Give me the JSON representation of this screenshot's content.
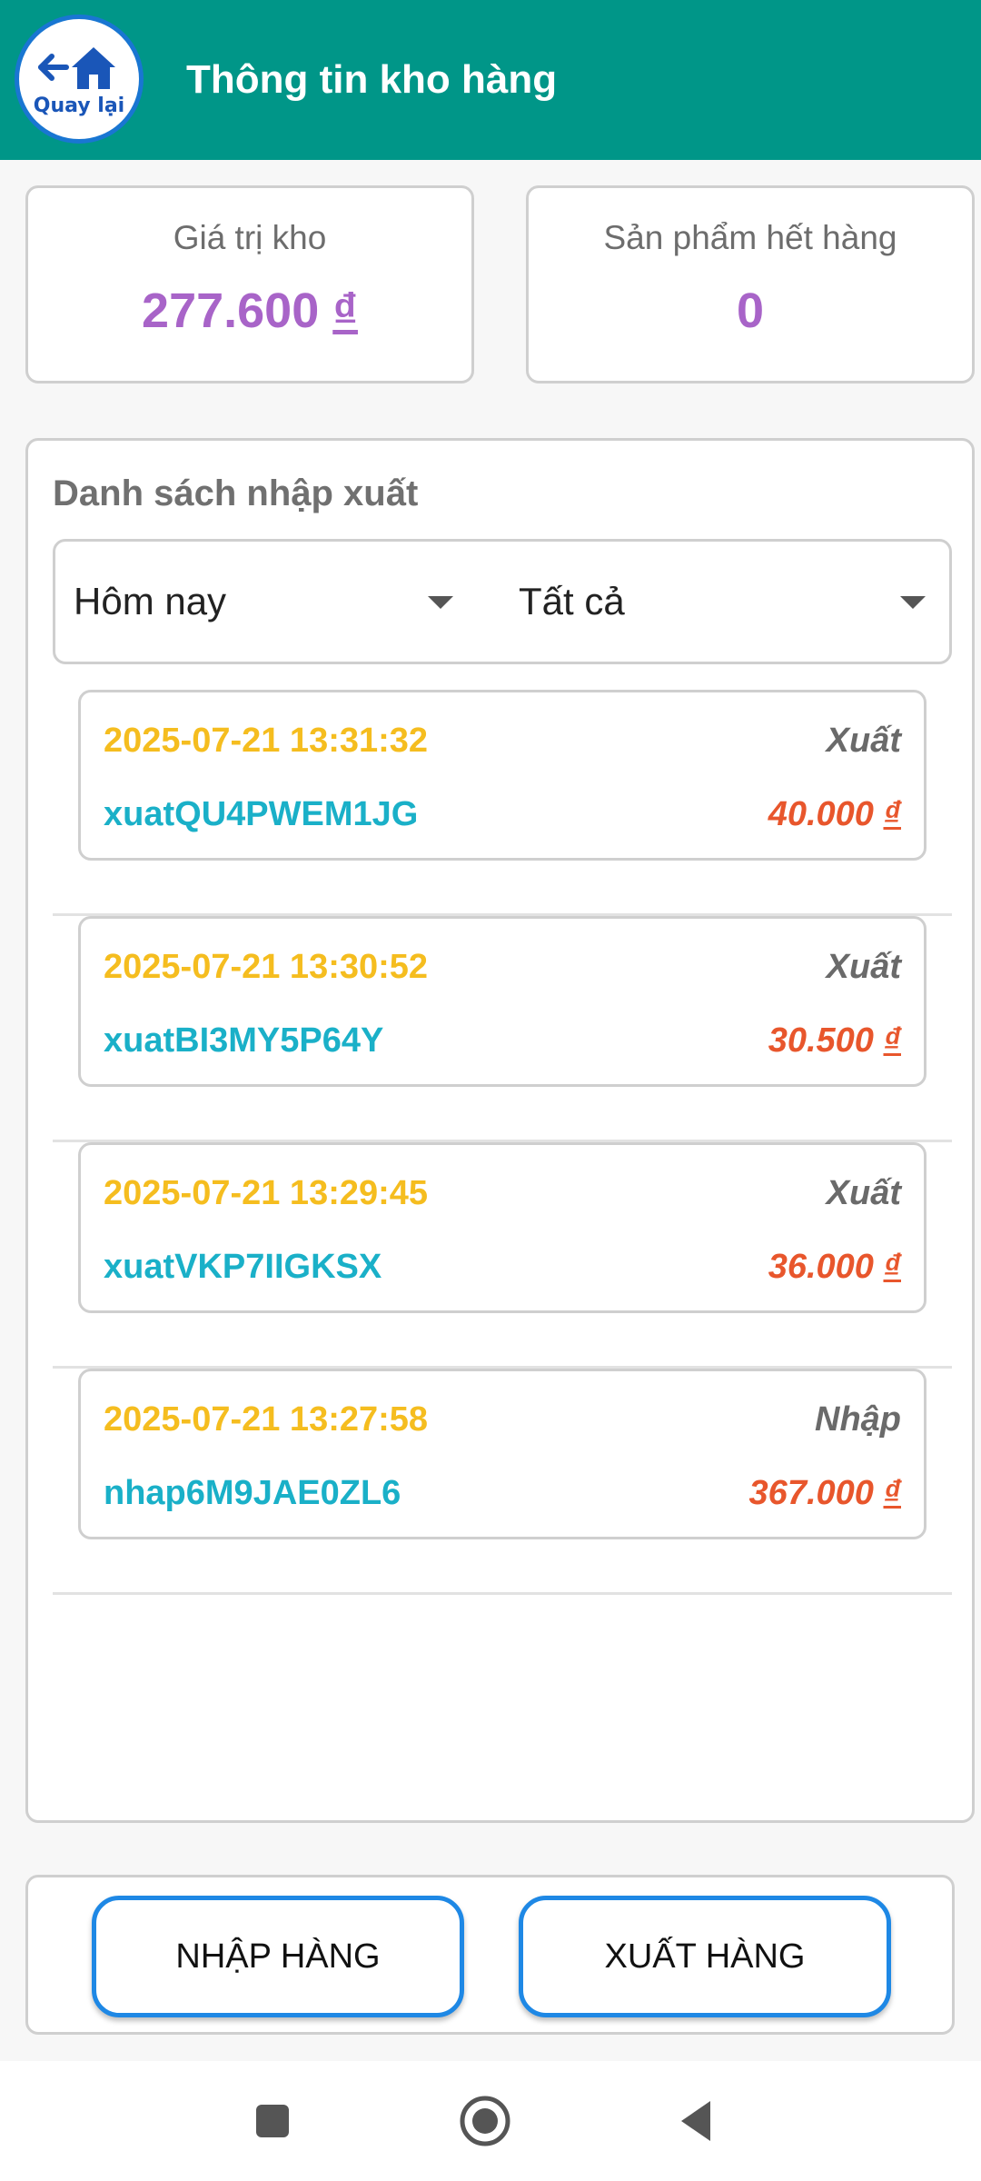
{
  "header": {
    "back_label": "Quay lại",
    "back_icon": "back-home-icon",
    "title": "Thông tin kho hàng",
    "color": "#009688"
  },
  "stats": {
    "inventory_value_label": "Giá trị kho",
    "inventory_value": "277.600",
    "out_of_stock_label": "Sản phẩm hết hàng",
    "out_of_stock_value": "0",
    "currency_symbol": "₫",
    "value_color": "#a864c8"
  },
  "list": {
    "title": "Danh sách nhập xuất",
    "filters": {
      "period_selected": "Hôm nay",
      "type_selected": "Tất cả"
    },
    "transactions": [
      {
        "time": "2025-07-21 13:31:32",
        "type": "Xuất",
        "code": "xuatQU4PWEM1JG",
        "amount": "40.000",
        "currency": "₫"
      },
      {
        "time": "2025-07-21 13:30:52",
        "type": "Xuất",
        "code": "xuatBI3MY5P64Y",
        "amount": "30.500",
        "currency": "₫"
      },
      {
        "time": "2025-07-21 13:29:45",
        "type": "Xuất",
        "code": "xuatVKP7IIGKSX",
        "amount": "36.000",
        "currency": "₫"
      },
      {
        "time": "2025-07-21 13:27:58",
        "type": "Nhập",
        "code": "nhap6M9JAE0ZL6",
        "amount": "367.000",
        "currency": "₫"
      }
    ],
    "colors": {
      "time": "#f5bd1f",
      "code": "#1ab0c8",
      "amount": "#e8562c",
      "type": "#6a6a6a"
    }
  },
  "actions": {
    "import_label": "NHẬP HÀNG",
    "export_label": "XUẤT HÀNG",
    "border_color": "#1e88e5"
  },
  "navbar": {
    "icons": [
      "recent-apps-icon",
      "home-icon",
      "back-icon"
    ]
  }
}
